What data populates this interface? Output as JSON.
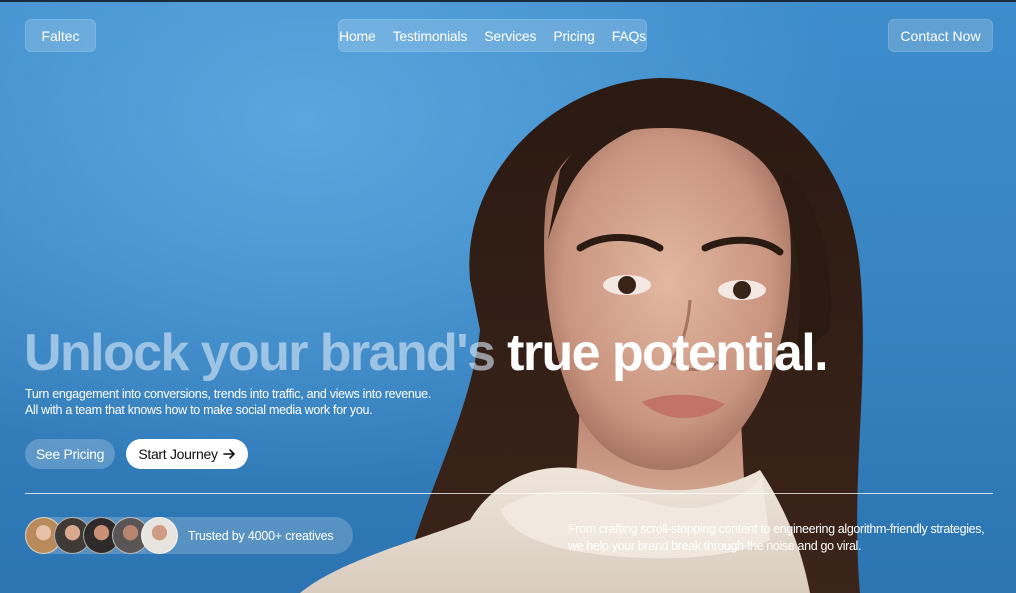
{
  "brand": {
    "name": "Faltec"
  },
  "nav": {
    "items": [
      {
        "label": "Home"
      },
      {
        "label": "Testimonials"
      },
      {
        "label": "Services"
      },
      {
        "label": "Pricing"
      },
      {
        "label": "FAQs"
      }
    ],
    "contact_label": "Contact Now"
  },
  "hero": {
    "headline_muted": "Unlock your brand's",
    "headline_bright": "true potential.",
    "subtext_line1": "Turn engagement into conversions, trends into traffic, and views into revenue.",
    "subtext_line2": "All with a team that knows how to make social media work for you.",
    "see_pricing_label": "See Pricing",
    "start_journey_label": "Start Journey",
    "arrow_icon": "arrow-right-icon"
  },
  "trust": {
    "label": "Trusted by 4000+ creatives",
    "avatar_count": 5
  },
  "blurb": {
    "line1": "From crafting scroll-stopping content to engineering algorithm-friendly strategies,",
    "line2": "we help your brand break through the noise and go viral."
  },
  "colors": {
    "sky": "#3a86c4",
    "accent_white": "#ffffff",
    "muted_headline": "#d6e6f5"
  }
}
